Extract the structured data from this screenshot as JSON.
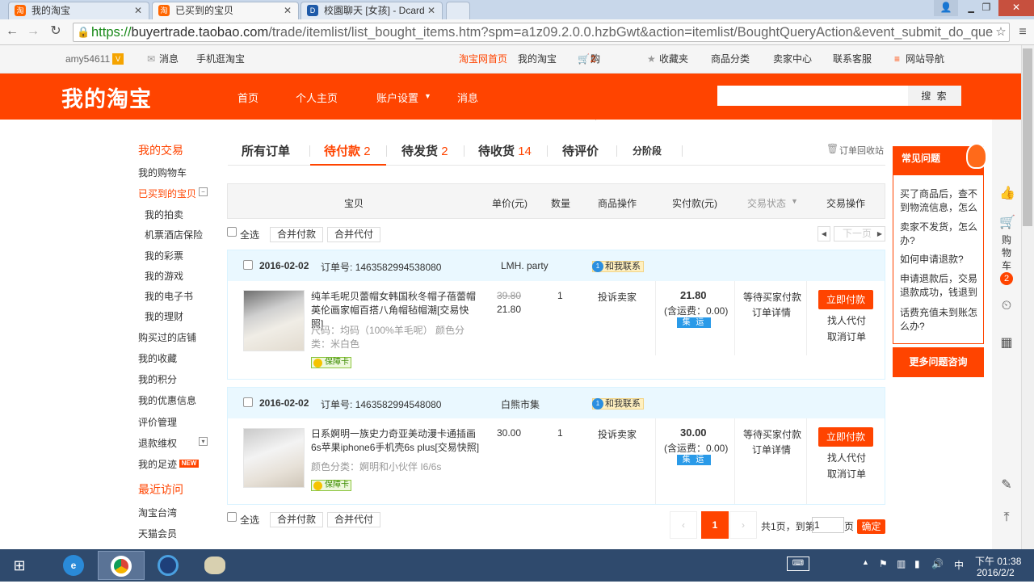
{
  "browser": {
    "tabs": [
      {
        "title": "我的淘宝",
        "icon": "淘"
      },
      {
        "title": "已买到的宝贝",
        "icon": "淘"
      },
      {
        "title": "校園聊天 [女孩] - Dcard",
        "icon": "D"
      }
    ],
    "url_scheme": "https://",
    "url_host": "buyertrade.taobao.com",
    "url_path": "/trade/itemlist/list_bought_items.htm?spm=a1z09.2.0.0.hzbGwt&action=itemlist/BoughtQueryAction&event_submit_do_que"
  },
  "site_top": {
    "user": "amy54611",
    "messages": "消息",
    "mobile": "手机逛淘宝",
    "home": "淘宝网首页",
    "my_taobao": "我的淘宝",
    "cart": "购物车",
    "cart_count": "2",
    "favorites": "收藏夹",
    "categories": "商品分类",
    "seller_center": "卖家中心",
    "contact_service": "联系客服",
    "site_nav": "网站导航"
  },
  "header": {
    "logo": "我的淘宝",
    "nav": [
      "首页",
      "个人主页",
      "账户设置",
      "消息"
    ],
    "search_button": "搜 索"
  },
  "left_nav": {
    "section1": "我的交易",
    "items1": [
      "我的购物车",
      "已买到的宝贝",
      "我的拍卖",
      "机票酒店保险",
      "我的彩票",
      "我的游戏",
      "我的电子书",
      "我的理财",
      "购买过的店铺",
      "我的收藏",
      "我的积分",
      "我的优惠信息",
      "评价管理",
      "退款维权",
      "我的足迹"
    ],
    "new_badge": "NEW",
    "section2": "最近访问",
    "items2": [
      "淘宝台湾",
      "天猫会员"
    ]
  },
  "order_tabs": {
    "all": "所有订单",
    "pending_pay": "待付款",
    "pending_pay_count": "2",
    "pending_ship": "待发货",
    "pending_ship_count": "2",
    "pending_recv": "待收货",
    "pending_recv_count": "14",
    "pending_review": "待评价",
    "installment": "分阶段",
    "recycle": "订单回收站"
  },
  "table_header": {
    "item": "宝贝",
    "unit_price": "单价(元)",
    "qty": "数量",
    "op": "商品操作",
    "paid": "实付款(元)",
    "status": "交易状态",
    "action": "交易操作"
  },
  "batch": {
    "select_all": "全选",
    "merge_pay": "合并付款",
    "merge_proxy": "合并代付",
    "next_page": "下一页"
  },
  "orders": [
    {
      "date": "2016-02-02",
      "order_no_label": "订单号:",
      "order_no": "1463582994538080",
      "shop": "LMH. party",
      "contact": "和我联系",
      "title": "纯羊毛呢贝蕾帽女韩国秋冬帽子蓓蕾帽英伦画家帽百搭八角帽毡帽潮[交易快照]",
      "spec": "尺码：均码（100%羊毛呢） 颜色分类：米白色",
      "guarantee": "保障卡",
      "orig_price": "39.80",
      "price": "21.80",
      "qty": "1",
      "complain": "投诉卖家",
      "total": "21.80",
      "shipping": "(含运费：0.00)",
      "jiyun": "集 运",
      "status": "等待买家付款",
      "detail": "订单详情",
      "pay": "立即付款",
      "proxy": "找人代付",
      "cancel": "取消订单"
    },
    {
      "date": "2016-02-02",
      "order_no_label": "订单号:",
      "order_no": "1463582994548080",
      "shop": "白熊市集",
      "contact": "和我联系",
      "title": "日系婀明一族史力奇亚美动漫卡通插画6s苹果iphone6手机壳6s plus[交易快照]",
      "spec": "颜色分类：婀明和小伙伴 I6/6s",
      "guarantee": "保障卡",
      "orig_price": "",
      "price": "30.00",
      "qty": "1",
      "complain": "投诉卖家",
      "total": "30.00",
      "shipping": "(含运费：0.00)",
      "jiyun": "集 运",
      "status": "等待买家付款",
      "detail": "订单详情",
      "pay": "立即付款",
      "proxy": "找人代付",
      "cancel": "取消订单"
    }
  ],
  "pager": {
    "current": "1",
    "summary": "共1页，到第",
    "input": "1",
    "page_unit": "页",
    "confirm": "确定"
  },
  "faq": {
    "title": "常见问题",
    "questions": [
      "买了商品后，查不到物流信息，怎么",
      "卖家不发货，怎么办?",
      "如何申请退款?",
      "申请退款后，交易退款成功，钱退到",
      "话费充值未到账怎么办?"
    ],
    "more": "更多问题咨询"
  },
  "right_sidebar": {
    "cart_label": "购物车",
    "cart_count": "2"
  },
  "taskbar": {
    "ime": "中",
    "time": "下午 01:38",
    "date": "2016/2/2"
  }
}
